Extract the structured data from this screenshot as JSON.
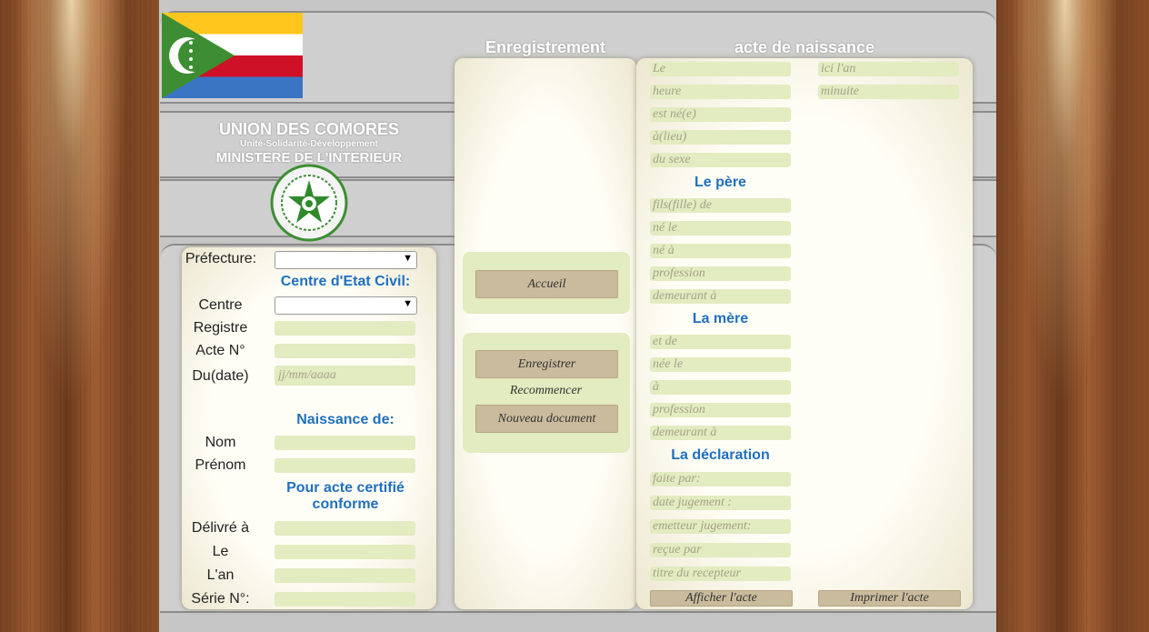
{
  "header": {
    "country": "UNION DES COMORES",
    "motto": "Unité-Solidarité-Développement",
    "ministry": "MINISTERE DE L'INTERIEUR"
  },
  "titles": {
    "left": "Enregistrement",
    "right": "acte de naissance"
  },
  "form": {
    "prefecture_label": "Préfecture:",
    "centre_heading": "Centre d'Etat Civil:",
    "centre_label": "Centre",
    "registre_label": "Registre",
    "acte_label": "Acte N°",
    "date_label": "Du(date)",
    "date_placeholder": "jj/mm/aaaa",
    "naissance_heading": "Naissance de:",
    "nom_label": "Nom",
    "prenom_label": "Prénom",
    "certifie_heading": "Pour acte certifié conforme",
    "delivre_label": "Délivré à",
    "le_label": "Le",
    "lan_label": "L'an",
    "serie_label": "Série N°:"
  },
  "nav": {
    "accueil": "Accueil",
    "enregistrer": "Enregistrer",
    "recommencer": "Recommencer",
    "nouveau": "Nouveau document"
  },
  "acte": {
    "le": "Le",
    "ici_lan": "ici l'an",
    "heure": "heure",
    "minuite": "minuite",
    "est_ne": "est né(e)",
    "a_lieu": "à(lieu)",
    "du_sexe": "du sexe",
    "pere_heading": "Le père",
    "fils_de": "fils(fille) de",
    "ne_le": "né le",
    "ne_a": "né à",
    "profession_p": "profession",
    "demeurant_p": "demeurant à",
    "mere_heading": "La mère",
    "et_de": "et de",
    "nee_le": "née le",
    "a_m": "à",
    "profession_m": "profession",
    "demeurant_m": "demeurant à",
    "declaration_heading": "La déclaration",
    "faite_par": "faite par:",
    "date_jugement": "date jugement :",
    "emetteur": "emetteur jugement:",
    "recue_par": "reçue par",
    "titre_recepteur": "titre du recepteur",
    "afficher": "Afficher l'acte",
    "imprimer": "Imprimer l'acte"
  },
  "colors": {
    "accent_blue": "#1f6fbf",
    "field_green": "#e3ebc0",
    "button_tan": "#c9bb9c"
  }
}
